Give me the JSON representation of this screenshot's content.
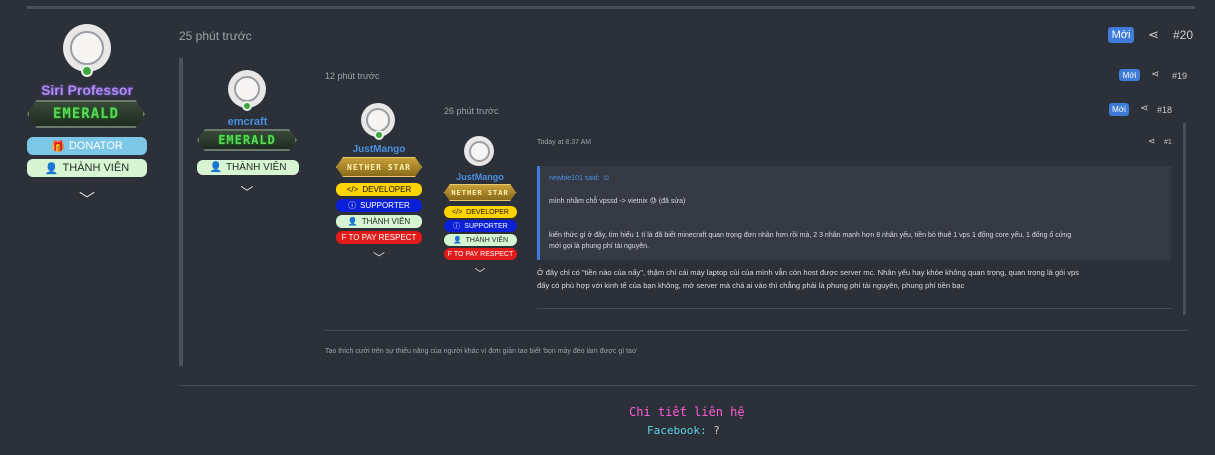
{
  "post20": {
    "time": "25 phút trước",
    "new_label": "Mới",
    "number": "#20",
    "user": {
      "name": "Siri Professor",
      "rank": "EMERALD",
      "badges": [
        "DONATOR",
        "THÀNH VIÊN"
      ]
    }
  },
  "post19": {
    "time": "12 phút trước",
    "new_label": "Mới",
    "number": "#19",
    "user": {
      "name": "emcraft",
      "rank": "EMERALD",
      "badges": [
        "THÀNH VIÊN"
      ]
    },
    "signature": "Tao thích cười trên sự thiểu năng của người khác vì đơn giản tao biết 'bọn mày đéo làm được gì tao'"
  },
  "post18": {
    "time": "26 phút trước",
    "new_label": "Mới",
    "number": "#18",
    "user": {
      "name": "JustMango",
      "rank": "NETHER STAR",
      "badges": [
        "DEVELOPER",
        "SUPPORTER",
        "THÀNH VIÊN",
        "F TO PAY RESPECT"
      ]
    }
  },
  "post1": {
    "time": "Today at 8:37 AM",
    "number": "#1",
    "user": {
      "name": "JustMango",
      "rank": "NETHER STAR",
      "badges": [
        "DEVELOPER",
        "SUPPORTER",
        "THÀNH VIÊN",
        "F TO PAY RESPECT"
      ]
    },
    "quote": {
      "author": "newbie101 said:",
      "line1": "mình nhầm chỗ vpssd -> vietnix 😓 (đã sửa)",
      "line2": "kiến thức gì ở đây, tìm hiểu 1 tí là đã biết minecraft quan trọng đơn nhân hơn rồi mà, 2 3 nhân mạnh hơn 8 nhân yếu, tiền bỏ thuê 1 vps 1 đống core yếu, 1 đống ổ cứng",
      "line3": "mới gọi là phung phí tài nguyên."
    },
    "body1": "Ở đây chỉ có \"tiền nào của nấy\", thậm chí cái máy laptop cùi của mình vẫn còn host được server mc. Nhân yếu hay khỏe không quan trọng, quan trọng là gói vps",
    "body2": "đấy có phù hợp với kinh tế của bạn không, mở server mà chả ai vào thì chẳng phải là phung phí tài nguyên, phung phí tiền bạc"
  },
  "contact": {
    "title": "Chi tiết liên hệ",
    "facebook_label": "Facebook:",
    "facebook_value": "?"
  },
  "colors": {
    "background": "#2c3038",
    "accent": "#3f7bd8",
    "online": "#3fa63f",
    "username_purple": "#b18cf0",
    "username_blue": "#4a90e2",
    "contact_pink": "#ff5cd8",
    "contact_cyan": "#5ad6e8"
  },
  "icons": [
    "share-icon",
    "gift-icon",
    "user-icon",
    "code-icon",
    "info-icon",
    "chevron-down-icon",
    "arrow-up-icon"
  ]
}
